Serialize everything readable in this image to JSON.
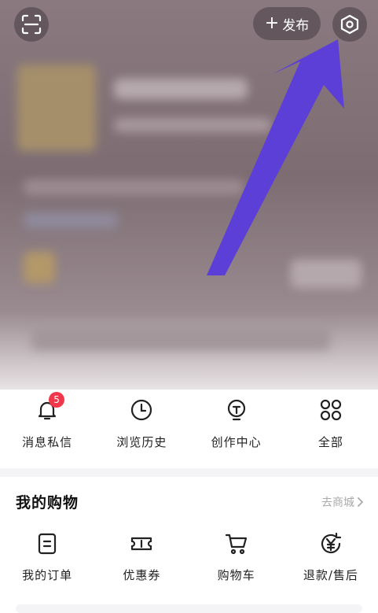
{
  "header": {
    "publish_label": "发布",
    "scan_icon": "scan-icon",
    "settings_icon": "settings-hexagon-icon"
  },
  "annotation": {
    "arrow_color": "#5b3fd6"
  },
  "quick_actions": [
    {
      "label": "消息私信",
      "icon": "bell-icon",
      "badge": "5"
    },
    {
      "label": "浏览历史",
      "icon": "clock-icon"
    },
    {
      "label": "创作中心",
      "icon": "lightbulb-icon"
    },
    {
      "label": "全部",
      "icon": "grid-icon"
    }
  ],
  "shopping": {
    "title": "我的购物",
    "link": "去商城",
    "items": [
      {
        "label": "我的订单",
        "icon": "order-icon"
      },
      {
        "label": "优惠券",
        "icon": "coupon-icon"
      },
      {
        "label": "购物车",
        "icon": "cart-icon"
      },
      {
        "label": "退款/售后",
        "icon": "refund-icon"
      }
    ]
  },
  "colors": {
    "badge": "#f0384a",
    "text": "#222222",
    "link": "#aaaaaa"
  }
}
